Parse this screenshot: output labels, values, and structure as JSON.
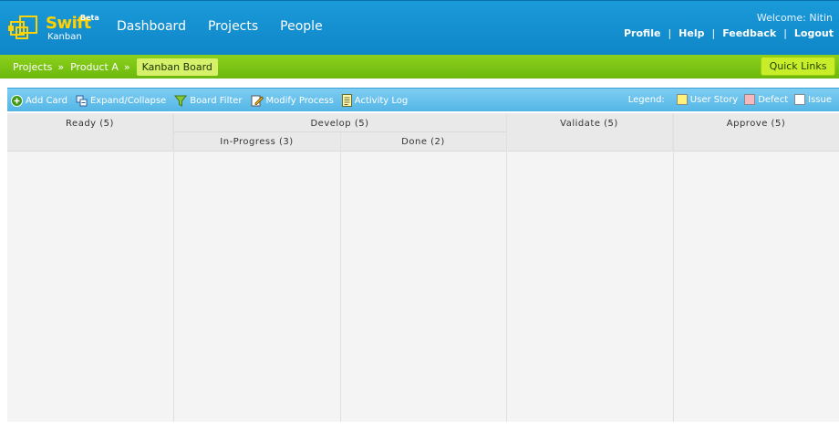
{
  "header": {
    "logo": {
      "name": "Swift",
      "beta": "Beta",
      "sub": "Kanban"
    },
    "nav": [
      "Dashboard",
      "Projects",
      "People"
    ],
    "welcome": "Welcome: Nitin",
    "user_links": [
      "Profile",
      "Help",
      "Feedback",
      "Logout"
    ]
  },
  "breadcrumb": {
    "items": [
      "Projects",
      "Product A"
    ],
    "current": "Kanban Board",
    "separator": "»"
  },
  "quick_links": "Quick Links",
  "toolbar": {
    "tools": [
      {
        "label": "Add Card",
        "icon": "add-icon"
      },
      {
        "label": "Expand/Collapse",
        "icon": "expand-collapse-icon"
      },
      {
        "label": "Board Filter",
        "icon": "filter-icon"
      },
      {
        "label": "Modify Process",
        "icon": "edit-icon"
      },
      {
        "label": "Activity Log",
        "icon": "log-icon"
      }
    ],
    "legend_label": "Legend:",
    "legend": [
      {
        "label": "User Story",
        "color": "#fff27a"
      },
      {
        "label": "Defect",
        "color": "#f7b7bf"
      },
      {
        "label": "Issue",
        "color": "#ffffff"
      }
    ]
  },
  "board": {
    "columns": {
      "ready": "Ready (5)",
      "develop": "Develop (5)",
      "in_progress": "In-Progress (3)",
      "done": "Done (2)",
      "validate": "Validate (5)",
      "approve": "Approve (5)"
    }
  },
  "colors": {
    "header_blue": "#1592d2",
    "crumb_green": "#7cc414",
    "toolbar_blue": "#64bdea",
    "board_bg": "#f4f4f4"
  }
}
